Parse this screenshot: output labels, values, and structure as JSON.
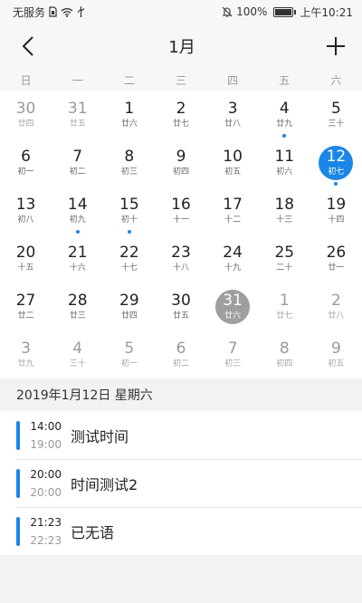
{
  "status_bar": {
    "carrier": "无服务",
    "battery_percent": "100%",
    "time": "上午10:21",
    "icons": [
      "sim-icon",
      "wifi-icon",
      "usb-icon",
      "mute-icon",
      "battery-icon"
    ]
  },
  "app_bar": {
    "title": "1月",
    "back_icon": "chevron-left-icon",
    "add_icon": "plus-icon"
  },
  "weekdays": [
    "日",
    "一",
    "二",
    "三",
    "四",
    "五",
    "六"
  ],
  "calendar": {
    "accent_color": "#1b86e6",
    "today_color": "#9e9e9e",
    "days": [
      {
        "day": "30",
        "lunar": "廿四",
        "other": true
      },
      {
        "day": "31",
        "lunar": "廿五",
        "other": true
      },
      {
        "day": "1",
        "lunar": "廿六"
      },
      {
        "day": "2",
        "lunar": "廿七"
      },
      {
        "day": "3",
        "lunar": "廿八"
      },
      {
        "day": "4",
        "lunar": "廿九",
        "dot": true
      },
      {
        "day": "5",
        "lunar": "三十"
      },
      {
        "day": "6",
        "lunar": "初一"
      },
      {
        "day": "7",
        "lunar": "初二"
      },
      {
        "day": "8",
        "lunar": "初三"
      },
      {
        "day": "9",
        "lunar": "初四"
      },
      {
        "day": "10",
        "lunar": "初五"
      },
      {
        "day": "11",
        "lunar": "初六"
      },
      {
        "day": "12",
        "lunar": "初七",
        "selected": true,
        "dot": true
      },
      {
        "day": "13",
        "lunar": "初八"
      },
      {
        "day": "14",
        "lunar": "初九",
        "dot": true
      },
      {
        "day": "15",
        "lunar": "初十",
        "dot": true
      },
      {
        "day": "16",
        "lunar": "十一"
      },
      {
        "day": "17",
        "lunar": "十二"
      },
      {
        "day": "18",
        "lunar": "十三"
      },
      {
        "day": "19",
        "lunar": "十四"
      },
      {
        "day": "20",
        "lunar": "十五"
      },
      {
        "day": "21",
        "lunar": "十六"
      },
      {
        "day": "22",
        "lunar": "十七"
      },
      {
        "day": "23",
        "lunar": "十八"
      },
      {
        "day": "24",
        "lunar": "十九"
      },
      {
        "day": "25",
        "lunar": "二十"
      },
      {
        "day": "26",
        "lunar": "廿一"
      },
      {
        "day": "27",
        "lunar": "廿二"
      },
      {
        "day": "28",
        "lunar": "廿三"
      },
      {
        "day": "29",
        "lunar": "廿四"
      },
      {
        "day": "30",
        "lunar": "廿五"
      },
      {
        "day": "31",
        "lunar": "廿六",
        "today": true
      },
      {
        "day": "1",
        "lunar": "廿七",
        "other": true
      },
      {
        "day": "2",
        "lunar": "廿八",
        "other": true
      },
      {
        "day": "3",
        "lunar": "廿九",
        "other": true
      },
      {
        "day": "4",
        "lunar": "三十",
        "other": true
      },
      {
        "day": "5",
        "lunar": "初一",
        "other": true
      },
      {
        "day": "6",
        "lunar": "初二",
        "other": true
      },
      {
        "day": "7",
        "lunar": "初三",
        "other": true
      },
      {
        "day": "8",
        "lunar": "初四",
        "other": true
      },
      {
        "day": "9",
        "lunar": "初五",
        "other": true
      }
    ]
  },
  "selected_date_label": "2019年1月12日 星期六",
  "events": [
    {
      "start": "14:00",
      "end": "19:00",
      "title": "测试时间"
    },
    {
      "start": "20:00",
      "end": "20:00",
      "title": "时间测试2"
    },
    {
      "start": "21:23",
      "end": "22:23",
      "title": "已无语"
    }
  ]
}
